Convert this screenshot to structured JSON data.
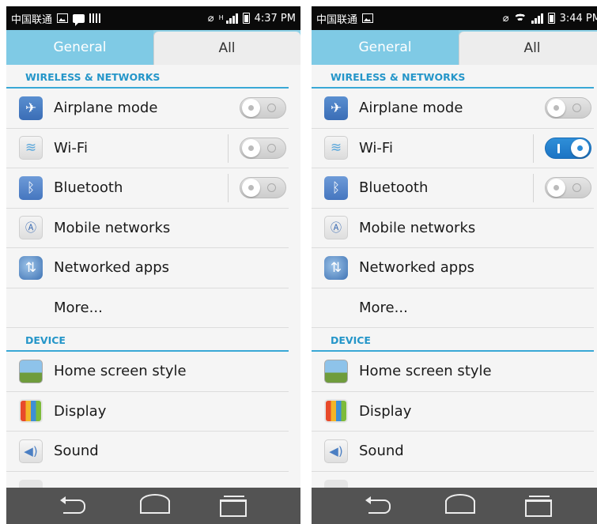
{
  "screens": [
    {
      "status": {
        "carrier": "中国联通",
        "time": "4:37 PM",
        "h_indicator": "H"
      },
      "tabs": {
        "general": "General",
        "all": "All"
      },
      "sections": {
        "wireless": "WIRELESS & NETWORKS",
        "device": "DEVICE"
      },
      "items": {
        "airplane": "Airplane mode",
        "wifi": "Wi-Fi",
        "bluetooth": "Bluetooth",
        "mobile": "Mobile networks",
        "netapps": "Networked apps",
        "more": "More...",
        "home": "Home screen style",
        "display": "Display",
        "sound": "Sound"
      },
      "toggles": {
        "airplane": "off",
        "wifi": "off",
        "bluetooth": "off"
      }
    },
    {
      "status": {
        "carrier": "中国联通",
        "time": "3:44 PM"
      },
      "tabs": {
        "general": "General",
        "all": "All"
      },
      "sections": {
        "wireless": "WIRELESS & NETWORKS",
        "device": "DEVICE"
      },
      "items": {
        "airplane": "Airplane mode",
        "wifi": "Wi-Fi",
        "bluetooth": "Bluetooth",
        "mobile": "Mobile networks",
        "netapps": "Networked apps",
        "more": "More...",
        "home": "Home screen style",
        "display": "Display",
        "sound": "Sound"
      },
      "toggles": {
        "airplane": "off",
        "wifi": "on",
        "bluetooth": "off"
      }
    }
  ],
  "icons": {
    "airplane": "airplane-icon",
    "wifi": "wifi-icon",
    "bluetooth": "bluetooth-icon",
    "mobile": "antenna-icon",
    "netapps": "globe-arrows-icon",
    "home": "home-screen-icon",
    "display": "monitor-icon",
    "sound": "speaker-icon"
  },
  "colors": {
    "accent": "#2596c9",
    "tab_active": "#7fcae5",
    "toggle_on": "#1c74c4",
    "nav_bar": "#535353"
  }
}
